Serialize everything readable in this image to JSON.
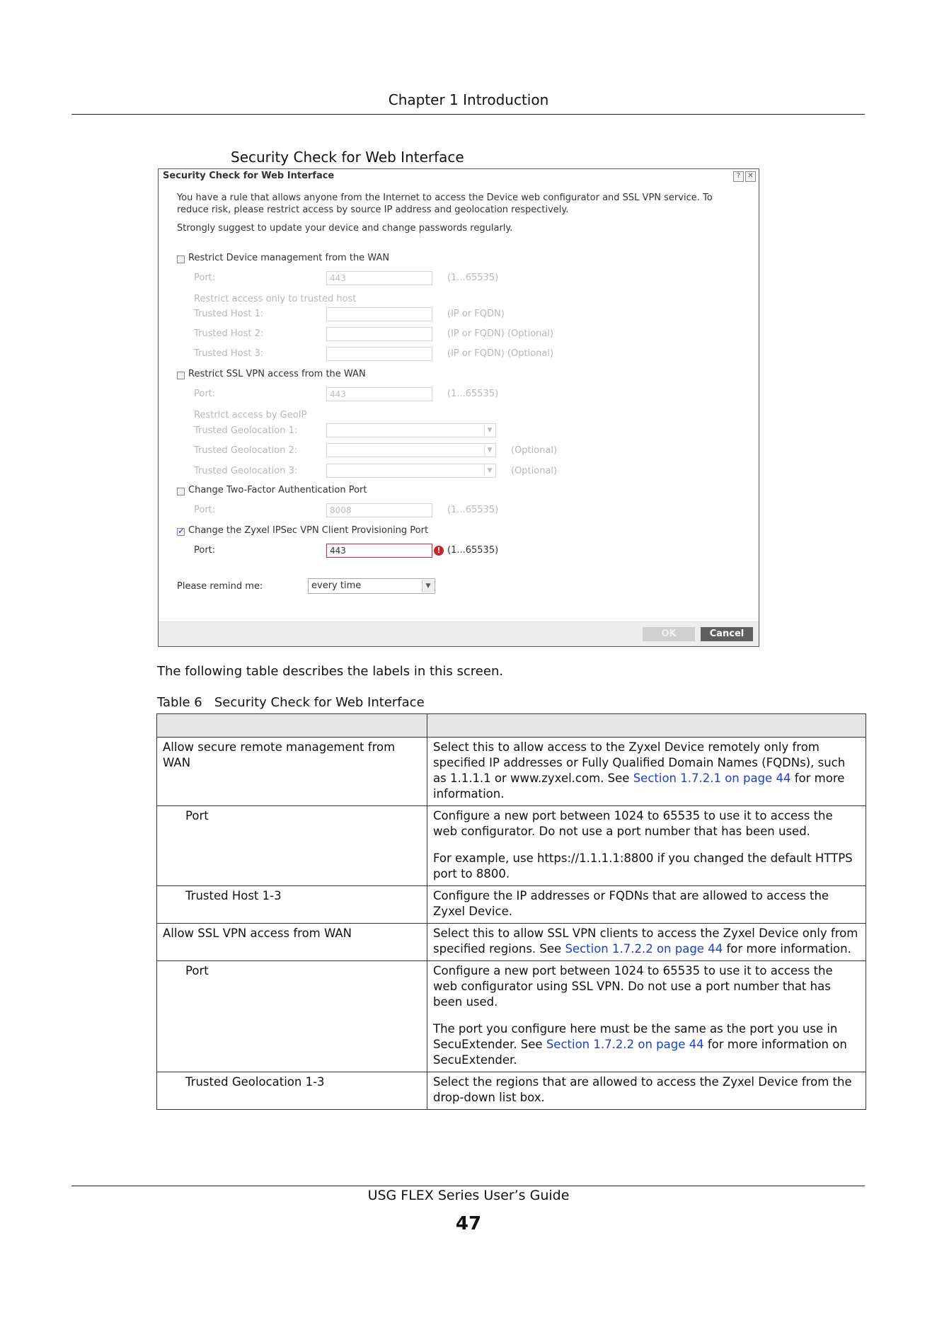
{
  "header": {
    "chapter": "Chapter 1 Introduction"
  },
  "figure": {
    "title": "Security Check for Web Interface"
  },
  "dialog": {
    "title": "Security Check for Web Interface",
    "icons": [
      "help-icon",
      "close-icon"
    ],
    "intro_line1": "You have a rule that allows anyone from the Internet to access the Device web configurator and SSL VPN service. To",
    "intro_line2": "reduce risk, please restrict access by source IP address and geolocation respectively.",
    "suggest": "Strongly suggest to update your device and change passwords regularly.",
    "opt1": {
      "label": "Restrict Device management from the WAN",
      "checked": false,
      "port_label": "Port:",
      "port_value": "443",
      "port_range": "(1...65535)",
      "sub": "Restrict access only to trusted host",
      "hosts": [
        {
          "label": "Trusted Host 1:",
          "hint": "(IP or FQDN)"
        },
        {
          "label": "Trusted Host 2:",
          "hint": "(IP or FQDN) (Optional)"
        },
        {
          "label": "Trusted Host 3:",
          "hint": "(IP or FQDN) (Optional)"
        }
      ]
    },
    "opt2": {
      "label": "Restrict SSL VPN access from the WAN",
      "checked": false,
      "port_label": "Port:",
      "port_value": "443",
      "port_range": "(1...65535)",
      "sub": "Restrict access by GeoIP",
      "geos": [
        {
          "label": "Trusted Geolocation 1:",
          "hint": ""
        },
        {
          "label": "Trusted Geolocation 2:",
          "hint": "(Optional)"
        },
        {
          "label": "Trusted Geolocation 3:",
          "hint": "(Optional)"
        }
      ]
    },
    "opt3": {
      "label": "Change Two-Factor Authentication Port",
      "checked": false,
      "port_label": "Port:",
      "port_value": "8008",
      "port_range": "(1...65535)"
    },
    "opt4": {
      "label": "Change the Zyxel IPSec VPN Client Provisioning Port",
      "checked": true,
      "port_label": "Port:",
      "port_value": "443",
      "port_range": "(1...65535)"
    },
    "remind": {
      "label": "Please remind me:",
      "value": "every time"
    },
    "buttons": {
      "ok": "OK",
      "cancel": "Cancel"
    }
  },
  "text": {
    "intro": "The following table describes the labels in this screen.",
    "table_caption": "Table 6   Security Check for Web Interface"
  },
  "table": {
    "r1": {
      "label": "Allow secure remote management from WAN",
      "d1": "Select this to allow access to the Zyxel Device remotely only from specified IP addresses or Fully Qualified Domain Names (FQDNs), such as 1.1.1.1 or www.zyxel.com. See ",
      "link": "Section 1.7.2.1 on page 44",
      "d2": " for more information."
    },
    "r2": {
      "label": "Port",
      "p1": "Configure a new port between 1024 to 65535 to use it to access the web configurator. Do not use a port number that has been used.",
      "p2": "For example, use https://1.1.1.1:8800 if you changed the default HTTPS port to 8800."
    },
    "r3": {
      "label": "Trusted Host 1-3",
      "d": "Configure the IP addresses or FQDNs that are allowed to access the Zyxel Device."
    },
    "r4": {
      "label": "Allow SSL VPN access from WAN",
      "d1": "Select this to allow SSL VPN clients to access the Zyxel Device only from specified regions. See ",
      "link": "Section 1.7.2.2 on page 44",
      "d2": " for more information."
    },
    "r5": {
      "label": "Port",
      "p1": "Configure a new port between 1024 to 65535 to use it to access the web configurator using SSL VPN. Do not use a port number that has been used.",
      "p2a": "The port you configure here must be the same as the port you use in SecuExtender. See ",
      "link": "Section 1.7.2.2 on page 44",
      "p2b": " for more information on SecuExtender."
    },
    "r6": {
      "label": "Trusted Geolocation 1-3",
      "d": "Select the regions that are allowed to access the Zyxel Device from the drop-down list box."
    }
  },
  "footer": {
    "guide": "USG FLEX Series User’s Guide",
    "page": "47"
  }
}
